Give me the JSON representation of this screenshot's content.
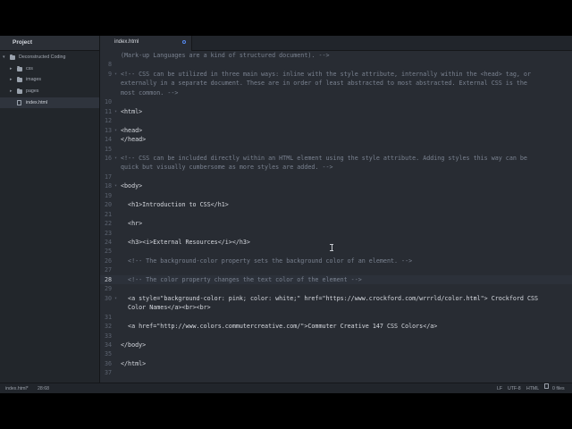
{
  "sidebar": {
    "title": "Project",
    "items": [
      {
        "label": "Deconstructed Coding",
        "type": "folder",
        "expanded": true,
        "depth": 0
      },
      {
        "label": "css",
        "type": "folder",
        "expanded": false,
        "depth": 1
      },
      {
        "label": "images",
        "type": "folder",
        "expanded": false,
        "depth": 1
      },
      {
        "label": "pages",
        "type": "folder",
        "expanded": false,
        "depth": 1
      },
      {
        "label": "index.html",
        "type": "file",
        "depth": 1,
        "selected": true
      }
    ]
  },
  "tabs": [
    {
      "label": "index.html",
      "modified": true,
      "active": true
    }
  ],
  "editor": {
    "current_line": "28",
    "lines": [
      {
        "n": "",
        "text": "(Mark-up Languages are a kind of structured document). -->",
        "kind": "comment"
      },
      {
        "n": "8",
        "text": "",
        "kind": "plain"
      },
      {
        "n": "9",
        "text": "<!-- CSS can be utilized in three main ways: inline with the style attribute, internally within the <head> tag, or",
        "kind": "comment",
        "fold": true
      },
      {
        "n": "",
        "text": "externally in a separate document. These are in order of least abstracted to most abstracted. External CSS is the",
        "kind": "comment"
      },
      {
        "n": "",
        "text": "most common. -->",
        "kind": "comment"
      },
      {
        "n": "10",
        "text": "",
        "kind": "plain"
      },
      {
        "n": "11",
        "text": "<html>",
        "kind": "tag",
        "fold": true
      },
      {
        "n": "12",
        "text": "",
        "kind": "plain"
      },
      {
        "n": "13",
        "text": "<head>",
        "kind": "tag",
        "fold": true
      },
      {
        "n": "14",
        "text": "</head>",
        "kind": "tag"
      },
      {
        "n": "15",
        "text": "",
        "kind": "plain"
      },
      {
        "n": "16",
        "text": "<!-- CSS can be included directly within an HTML element using the style attribute. Adding styles this way can be",
        "kind": "comment",
        "fold": true
      },
      {
        "n": "",
        "text": "quick but visually cumbersome as more styles are added. -->",
        "kind": "comment"
      },
      {
        "n": "17",
        "text": "",
        "kind": "plain"
      },
      {
        "n": "18",
        "text": "<body>",
        "kind": "tag",
        "fold": true
      },
      {
        "n": "19",
        "text": "",
        "kind": "plain"
      },
      {
        "n": "20",
        "text": "  <h1>Introduction to CSS</h1>",
        "kind": "tag"
      },
      {
        "n": "21",
        "text": "",
        "kind": "plain"
      },
      {
        "n": "22",
        "text": "  <hr>",
        "kind": "tag"
      },
      {
        "n": "23",
        "text": "",
        "kind": "plain"
      },
      {
        "n": "24",
        "text": "  <h3><i>External Resources</i></h3>",
        "kind": "tag"
      },
      {
        "n": "25",
        "text": "",
        "kind": "plain"
      },
      {
        "n": "26",
        "text": "  <!-- The background-color property sets the background color of an element. -->",
        "kind": "comment"
      },
      {
        "n": "27",
        "text": "",
        "kind": "plain"
      },
      {
        "n": "28",
        "text": "  <!-- The color property changes the text color of the element -->",
        "kind": "comment",
        "current": true
      },
      {
        "n": "29",
        "text": "",
        "kind": "plain"
      },
      {
        "n": "30",
        "text": "  <a style=\"background-color: pink; color: white;\" href=\"https://www.crockford.com/wrrrld/color.html\"> Crockford CSS",
        "kind": "tag",
        "fold": true
      },
      {
        "n": "",
        "text": "  Color Names</a><br><br>",
        "kind": "tag"
      },
      {
        "n": "31",
        "text": "",
        "kind": "plain"
      },
      {
        "n": "32",
        "text": "  <a href=\"http://www.colors.commutercreative.com/\">Commuter Creative 147 CSS Colors</a>",
        "kind": "tag"
      },
      {
        "n": "33",
        "text": "",
        "kind": "plain"
      },
      {
        "n": "34",
        "text": "</body>",
        "kind": "tag"
      },
      {
        "n": "35",
        "text": "",
        "kind": "plain"
      },
      {
        "n": "36",
        "text": "</html>",
        "kind": "tag"
      },
      {
        "n": "37",
        "text": "",
        "kind": "plain"
      }
    ]
  },
  "status_bar": {
    "file": "index.html*",
    "cursor": "28:68",
    "line_ending": "LF",
    "encoding": "UTF-8",
    "grammar": "HTML",
    "files": "0 files"
  },
  "icons": {
    "folder": "folder-icon",
    "file": "file-icon",
    "chevron_right": "chevron-right-icon",
    "chevron_down": "chevron-down-icon",
    "fold": "fold-arrow-icon",
    "cursor": "text-cursor-icon"
  },
  "colors": {
    "editor_bg": "#282c33",
    "sidebar_bg": "#22262b",
    "comment": "#7a8290",
    "text": "#d7dae0",
    "accent": "#568af2"
  }
}
